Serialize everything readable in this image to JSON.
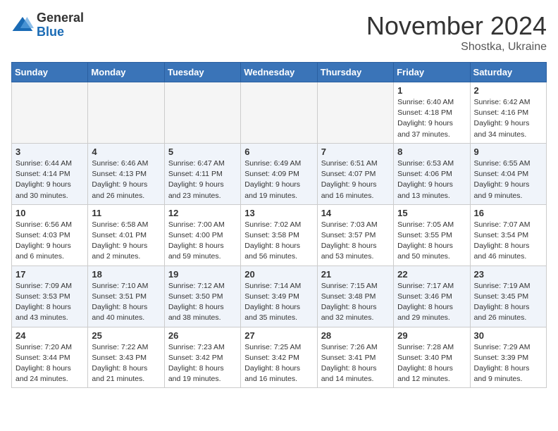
{
  "logo": {
    "general": "General",
    "blue": "Blue"
  },
  "title": "November 2024",
  "location": "Shostka, Ukraine",
  "headers": [
    "Sunday",
    "Monday",
    "Tuesday",
    "Wednesday",
    "Thursday",
    "Friday",
    "Saturday"
  ],
  "weeks": [
    [
      {
        "day": "",
        "info": ""
      },
      {
        "day": "",
        "info": ""
      },
      {
        "day": "",
        "info": ""
      },
      {
        "day": "",
        "info": ""
      },
      {
        "day": "",
        "info": ""
      },
      {
        "day": "1",
        "info": "Sunrise: 6:40 AM\nSunset: 4:18 PM\nDaylight: 9 hours\nand 37 minutes."
      },
      {
        "day": "2",
        "info": "Sunrise: 6:42 AM\nSunset: 4:16 PM\nDaylight: 9 hours\nand 34 minutes."
      }
    ],
    [
      {
        "day": "3",
        "info": "Sunrise: 6:44 AM\nSunset: 4:14 PM\nDaylight: 9 hours\nand 30 minutes."
      },
      {
        "day": "4",
        "info": "Sunrise: 6:46 AM\nSunset: 4:13 PM\nDaylight: 9 hours\nand 26 minutes."
      },
      {
        "day": "5",
        "info": "Sunrise: 6:47 AM\nSunset: 4:11 PM\nDaylight: 9 hours\nand 23 minutes."
      },
      {
        "day": "6",
        "info": "Sunrise: 6:49 AM\nSunset: 4:09 PM\nDaylight: 9 hours\nand 19 minutes."
      },
      {
        "day": "7",
        "info": "Sunrise: 6:51 AM\nSunset: 4:07 PM\nDaylight: 9 hours\nand 16 minutes."
      },
      {
        "day": "8",
        "info": "Sunrise: 6:53 AM\nSunset: 4:06 PM\nDaylight: 9 hours\nand 13 minutes."
      },
      {
        "day": "9",
        "info": "Sunrise: 6:55 AM\nSunset: 4:04 PM\nDaylight: 9 hours\nand 9 minutes."
      }
    ],
    [
      {
        "day": "10",
        "info": "Sunrise: 6:56 AM\nSunset: 4:03 PM\nDaylight: 9 hours\nand 6 minutes."
      },
      {
        "day": "11",
        "info": "Sunrise: 6:58 AM\nSunset: 4:01 PM\nDaylight: 9 hours\nand 2 minutes."
      },
      {
        "day": "12",
        "info": "Sunrise: 7:00 AM\nSunset: 4:00 PM\nDaylight: 8 hours\nand 59 minutes."
      },
      {
        "day": "13",
        "info": "Sunrise: 7:02 AM\nSunset: 3:58 PM\nDaylight: 8 hours\nand 56 minutes."
      },
      {
        "day": "14",
        "info": "Sunrise: 7:03 AM\nSunset: 3:57 PM\nDaylight: 8 hours\nand 53 minutes."
      },
      {
        "day": "15",
        "info": "Sunrise: 7:05 AM\nSunset: 3:55 PM\nDaylight: 8 hours\nand 50 minutes."
      },
      {
        "day": "16",
        "info": "Sunrise: 7:07 AM\nSunset: 3:54 PM\nDaylight: 8 hours\nand 46 minutes."
      }
    ],
    [
      {
        "day": "17",
        "info": "Sunrise: 7:09 AM\nSunset: 3:53 PM\nDaylight: 8 hours\nand 43 minutes."
      },
      {
        "day": "18",
        "info": "Sunrise: 7:10 AM\nSunset: 3:51 PM\nDaylight: 8 hours\nand 40 minutes."
      },
      {
        "day": "19",
        "info": "Sunrise: 7:12 AM\nSunset: 3:50 PM\nDaylight: 8 hours\nand 38 minutes."
      },
      {
        "day": "20",
        "info": "Sunrise: 7:14 AM\nSunset: 3:49 PM\nDaylight: 8 hours\nand 35 minutes."
      },
      {
        "day": "21",
        "info": "Sunrise: 7:15 AM\nSunset: 3:48 PM\nDaylight: 8 hours\nand 32 minutes."
      },
      {
        "day": "22",
        "info": "Sunrise: 7:17 AM\nSunset: 3:46 PM\nDaylight: 8 hours\nand 29 minutes."
      },
      {
        "day": "23",
        "info": "Sunrise: 7:19 AM\nSunset: 3:45 PM\nDaylight: 8 hours\nand 26 minutes."
      }
    ],
    [
      {
        "day": "24",
        "info": "Sunrise: 7:20 AM\nSunset: 3:44 PM\nDaylight: 8 hours\nand 24 minutes."
      },
      {
        "day": "25",
        "info": "Sunrise: 7:22 AM\nSunset: 3:43 PM\nDaylight: 8 hours\nand 21 minutes."
      },
      {
        "day": "26",
        "info": "Sunrise: 7:23 AM\nSunset: 3:42 PM\nDaylight: 8 hours\nand 19 minutes."
      },
      {
        "day": "27",
        "info": "Sunrise: 7:25 AM\nSunset: 3:42 PM\nDaylight: 8 hours\nand 16 minutes."
      },
      {
        "day": "28",
        "info": "Sunrise: 7:26 AM\nSunset: 3:41 PM\nDaylight: 8 hours\nand 14 minutes."
      },
      {
        "day": "29",
        "info": "Sunrise: 7:28 AM\nSunset: 3:40 PM\nDaylight: 8 hours\nand 12 minutes."
      },
      {
        "day": "30",
        "info": "Sunrise: 7:29 AM\nSunset: 3:39 PM\nDaylight: 8 hours\nand 9 minutes."
      }
    ]
  ]
}
